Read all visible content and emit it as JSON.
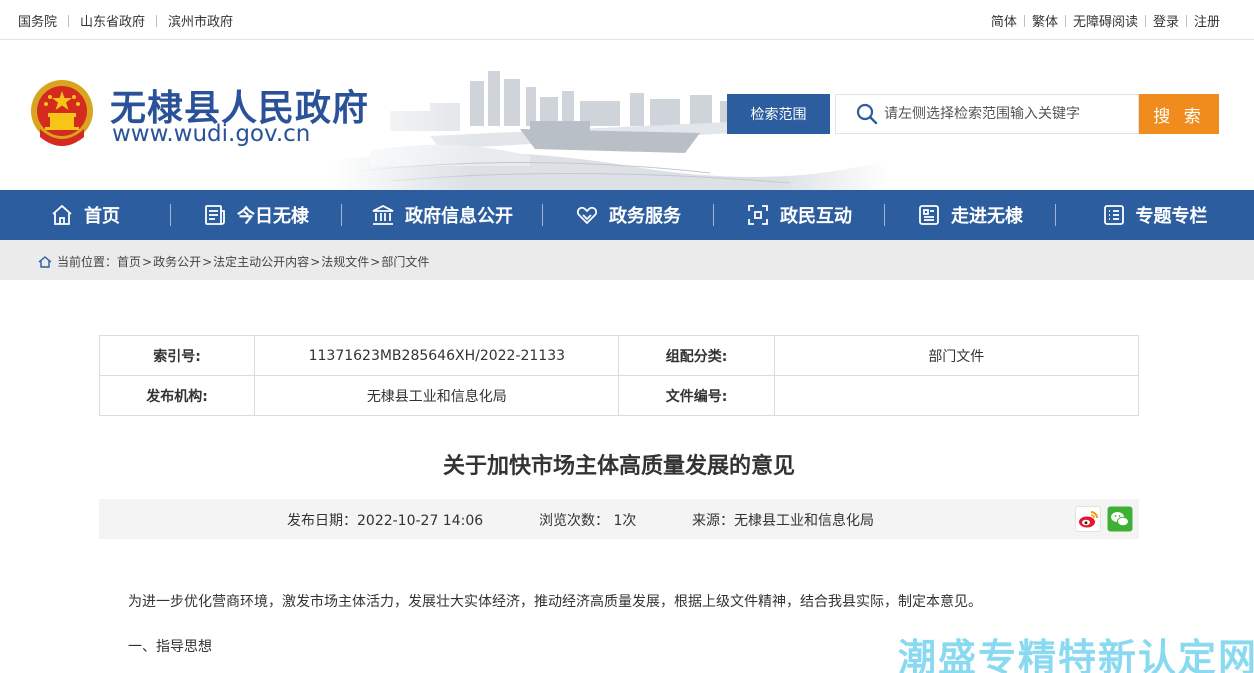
{
  "topbar": {
    "links_left": [
      "国务院",
      "山东省政府",
      "滨州市政府"
    ],
    "links_right": [
      "简体",
      "繁体",
      "无障碍阅读",
      "登录",
      "注册"
    ]
  },
  "header": {
    "site_title": "无棣县人民政府",
    "site_url": "www.wudi.gov.cn",
    "search_scope_label": "检索范围",
    "search_placeholder": "请左侧选择检索范围输入关键字",
    "search_button": "搜 索"
  },
  "nav": {
    "items": [
      {
        "label": "首页",
        "icon": "home-icon"
      },
      {
        "label": "今日无棣",
        "icon": "news-icon"
      },
      {
        "label": "政府信息公开",
        "icon": "government-building-icon"
      },
      {
        "label": "政务服务",
        "icon": "handshake-icon"
      },
      {
        "label": "政民互动",
        "icon": "interaction-icon"
      },
      {
        "label": "走进无棣",
        "icon": "info-card-icon"
      },
      {
        "label": "专题专栏",
        "icon": "list-icon"
      }
    ]
  },
  "breadcrumb": {
    "prefix": "当前位置：",
    "items": [
      "首页",
      "政务公开",
      "法定主动公开内容",
      "法规文件",
      "部门文件"
    ],
    "separator": ">"
  },
  "info": {
    "index_label": "索引号:",
    "index_value": "11371623MB285646XH/2022-21133",
    "category_label": "组配分类:",
    "category_value": "部门文件",
    "publisher_label": "发布机构:",
    "publisher_value": "无棣县工业和信息化局",
    "doc_no_label": "文件编号:",
    "doc_no_value": ""
  },
  "article": {
    "title": "关于加快市场主体高质量发展的意见",
    "publish_date": "发布日期：2022-10-27 14:06",
    "views": "浏览次数： 1次",
    "source": "来源：无棣县工业和信息化局",
    "paragraph_1": "为进一步优化营商环境，激发市场主体活力，发展壮大实体经济，推动经济高质量发展，根据上级文件精神，结合我县实际，制定本意见。",
    "heading_1": "一、指导思想"
  },
  "share_icons": [
    "weibo-icon",
    "wechat-icon"
  ],
  "watermark": "潮盛专精特新认定网",
  "colors": {
    "primary_blue": "#2c5d9e",
    "search_orange": "#f08c1e",
    "title_blue": "#2a5298"
  }
}
